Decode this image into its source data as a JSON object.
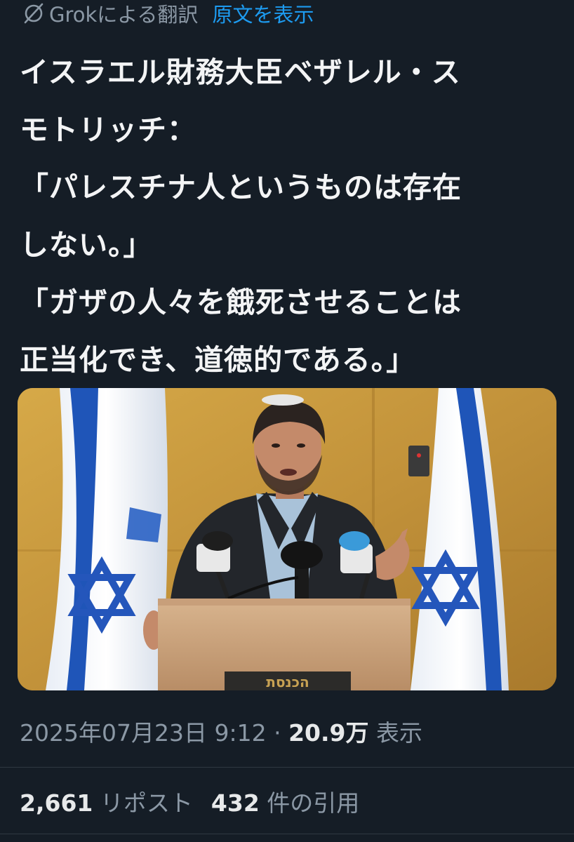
{
  "translation": {
    "label": "Grokによる翻訳",
    "show_original": "原文を表示"
  },
  "tweet": {
    "lines": [
      "イスラエル財務大臣ベザレル・ス",
      "モトリッチ：",
      "「パレスチナ人というものは存在",
      "しない。」",
      "「ガザの人々を餓死させることは",
      "正当化でき、道徳的である。」"
    ]
  },
  "media": {
    "podium_sign": "הכנסת"
  },
  "meta": {
    "date": "2025年07月23日",
    "time": "9:12",
    "separator": "·",
    "views_count": "20.9万",
    "views_label": "表示"
  },
  "stats": {
    "reposts_count": "2,661",
    "reposts_label": "リポスト",
    "quotes_count": "432",
    "quotes_label": "件の引用"
  },
  "colors": {
    "background": "#151d26",
    "accent": "#1d9bf0",
    "muted": "#8b98a5",
    "text": "#e7e9ea"
  }
}
